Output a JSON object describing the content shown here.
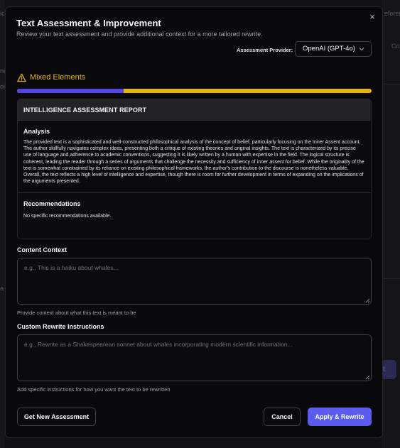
{
  "background": {
    "frag_top": "ic",
    "frag_left_1": "ne",
    "frag_left_2": "oi",
    "frag_left_3": "a",
    "frag_right_1": "eferen",
    "frag_right_2": "Co",
    "frag_button": "xt"
  },
  "dialog": {
    "title": "Text Assessment & Improvement",
    "subtitle": "Review your text assessment and provide additional context for a more tailored rewrite.",
    "close_symbol": "×"
  },
  "provider": {
    "label": "Assessment Provider:",
    "selected": "OpenAI (GPT-4o)"
  },
  "assessment": {
    "status_text": "Mixed Elements",
    "status_color": "#eab308",
    "score_fraction": 0.3,
    "bar_primary_color": "#4f46e5"
  },
  "report": {
    "heading": "INTELLIGENCE ASSESSMENT REPORT",
    "analysis_title": "Analysis",
    "analysis_text": "The provided text is a sophisticated and well-constructed philosophical analysis of the concept of belief, particularly focusing on the Inner Assent account. The author skillfully navigates complex ideas, presenting both a critique of existing theories and original insights. The text is characterized by its precise use of language and adherence to academic conventions, suggesting it is likely written by a human with expertise in the field. The logical structure is coherent, leading the reader through a series of arguments that challenge the necessity and sufficiency of inner assent for belief. While the originality of the text is somewhat constrained by its reliance on existing philosophical frameworks, the author's contribution to the discourse is nonetheless valuable. Overall, the text reflects a high level of intelligence and expertise, though there is room for further development in terms of expanding on the implications of the arguments presented.",
    "recommendations_title": "Recommendations",
    "recommendations_text": "No specific recommendations available."
  },
  "context_field": {
    "label": "Content Context",
    "placeholder": "e.g., This is a haiku about whales...",
    "value": "",
    "help": "Provide context about what this text is meant to be"
  },
  "instructions_field": {
    "label": "Custom Rewrite Instructions",
    "placeholder": "e.g., Rewrite as a Shakespearean sonnet about whales incorporating modern scientific information...",
    "value": "",
    "help": "Add specific instructions for how you want the text to be rewritten"
  },
  "buttons": {
    "new_assessment": "Get New Assessment",
    "cancel": "Cancel",
    "apply": "Apply & Rewrite"
  },
  "icons": {
    "close": "close-icon",
    "dropdown": "chevron-down-icon",
    "warning": "warning-triangle-icon",
    "resize": "resize-grip-icon"
  }
}
